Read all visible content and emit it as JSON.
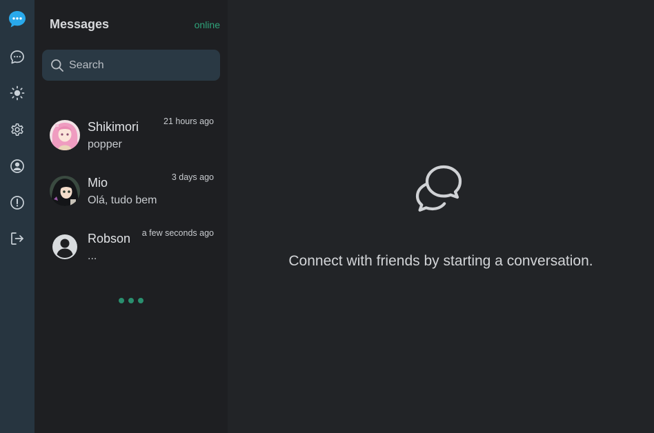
{
  "sidebar": {
    "items": [
      {
        "icon": "chat-bubble-filled-icon",
        "active": true
      },
      {
        "icon": "chat-bubble-icon"
      },
      {
        "icon": "sun-icon"
      },
      {
        "icon": "gear-icon"
      },
      {
        "icon": "user-circle-icon"
      },
      {
        "icon": "alert-circle-icon"
      },
      {
        "icon": "logout-icon"
      }
    ],
    "accent": "#29a9eb",
    "icon_color": "#c9d1d8"
  },
  "panel": {
    "title": "Messages",
    "status": "online",
    "status_color": "#2fa37a"
  },
  "search": {
    "placeholder": "Search",
    "icon": "search-icon"
  },
  "conversations": [
    {
      "name": "Shikimori",
      "time": "21 hours ago",
      "preview": "popper",
      "avatar": "anime-pink-hair"
    },
    {
      "name": "Mio",
      "time": "3 days ago",
      "preview": "Olá, tudo bem",
      "avatar": "anime-dark-hair"
    },
    {
      "name": "Robson",
      "time": "a few seconds ago",
      "preview": "...",
      "avatar": "default-user"
    }
  ],
  "main": {
    "empty_icon": "chat-bubbles-icon",
    "empty_text": "Connect with friends by starting a conversation."
  }
}
